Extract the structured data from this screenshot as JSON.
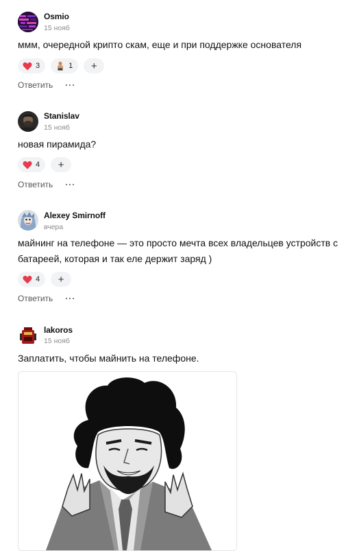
{
  "comments": [
    {
      "author": "Osmio",
      "date": "15 нояб",
      "text": "ммм, очередной крипто скам, еще и при поддержке основателя",
      "reactions": [
        {
          "icon": "heart-icon",
          "count": "3"
        },
        {
          "icon": "person-emoji-icon",
          "count": "1"
        }
      ],
      "add_reaction": "+",
      "reply_label": "Ответить",
      "more_label": "···"
    },
    {
      "author": "Stanislav",
      "date": "15 нояб",
      "text": "новая пирамида?",
      "reactions": [
        {
          "icon": "heart-icon",
          "count": "4"
        }
      ],
      "add_reaction": "+",
      "reply_label": "Ответить",
      "more_label": "···"
    },
    {
      "author": "Alexey Smirnoff",
      "date": "вчера",
      "text": "майнинг на телефоне — это просто мечта всех владельцев устройств с батареей, которая и так еле держит заряд )",
      "reactions": [
        {
          "icon": "heart-icon",
          "count": "4"
        }
      ],
      "add_reaction": "+",
      "reply_label": "Ответить",
      "more_label": "···"
    },
    {
      "author": "lakoros",
      "date": "15 нояб",
      "text": "Заплатить, чтобы майнить на телефоне.",
      "image": "aliens-guy-meme"
    }
  ],
  "colors": {
    "heart": "#e8394d",
    "reaction_bg": "#f2f3f5",
    "meta": "#8a8a8a"
  }
}
